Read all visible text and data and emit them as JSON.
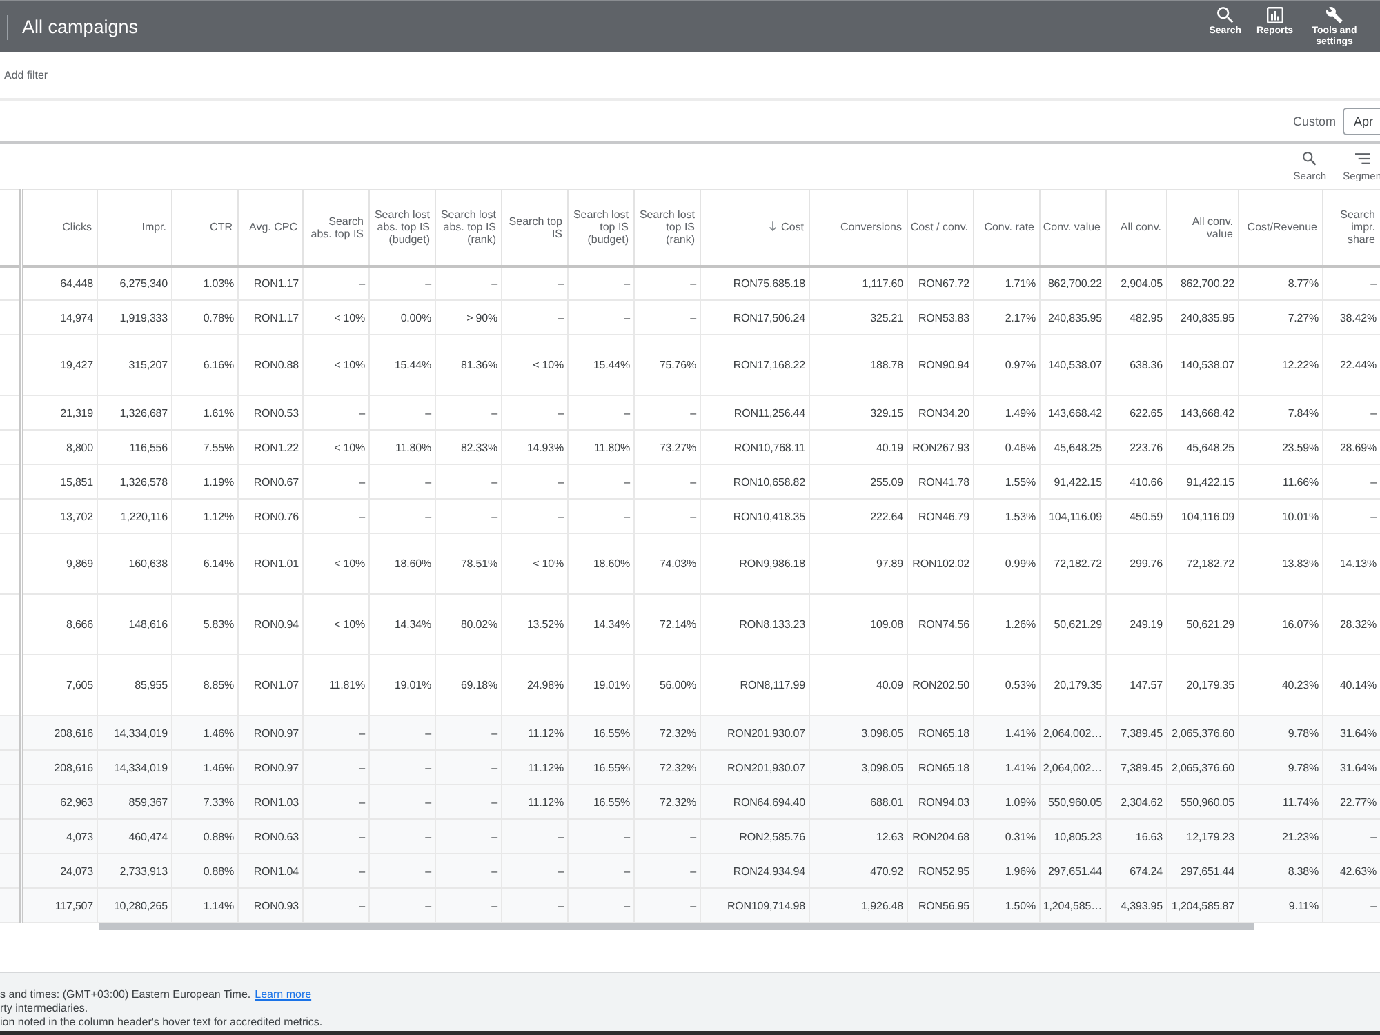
{
  "header": {
    "title": "All campaigns",
    "actions": [
      {
        "kind": "search",
        "label": "Search"
      },
      {
        "kind": "reports",
        "label": "Reports"
      },
      {
        "kind": "tools",
        "label": "Tools and settings"
      }
    ]
  },
  "filter_bar": {
    "label": "Add filter"
  },
  "date_range": {
    "preset": "Custom",
    "value": "Apr"
  },
  "toolbar": [
    {
      "kind": "search",
      "label": "Search"
    },
    {
      "kind": "segment",
      "label": "Segmen"
    }
  ],
  "table": {
    "columns": [
      {
        "label": "Clicks",
        "sorted": false
      },
      {
        "label": "Impr.",
        "sorted": false
      },
      {
        "label": "CTR",
        "sorted": false
      },
      {
        "label": "Avg. CPC",
        "sorted": false
      },
      {
        "label": "Search abs. top IS",
        "sorted": false
      },
      {
        "label": "Search lost abs. top IS (budget)",
        "sorted": false
      },
      {
        "label": "Search lost abs. top IS (rank)",
        "sorted": false
      },
      {
        "label": "Search top IS",
        "sorted": false
      },
      {
        "label": "Search lost top IS (budget)",
        "sorted": false
      },
      {
        "label": "Search lost top IS (rank)",
        "sorted": false
      },
      {
        "label": "Cost",
        "sorted": true
      },
      {
        "label": "Conversions",
        "sorted": false
      },
      {
        "label": "Cost / conv.",
        "sorted": false
      },
      {
        "label": "Conv. rate",
        "sorted": false
      },
      {
        "label": "Conv. value",
        "sorted": false
      },
      {
        "label": "All conv.",
        "sorted": false
      },
      {
        "label": "All conv. value",
        "sorted": false
      },
      {
        "label": "Cost/Revenue",
        "sorted": false
      },
      {
        "label": "Search impr. share",
        "sorted": false
      }
    ],
    "rows": [
      {
        "kind": "campaign",
        "tall": false,
        "cells": [
          "64,448",
          "6,275,340",
          "1.03%",
          "RON1.17",
          "–",
          "–",
          "–",
          "–",
          "–",
          "–",
          "RON75,685.18",
          "1,117.60",
          "RON67.72",
          "1.71%",
          "862,700.22",
          "2,904.05",
          "862,700.22",
          "8.77%",
          "–"
        ]
      },
      {
        "kind": "campaign",
        "tall": false,
        "cells": [
          "14,974",
          "1,919,333",
          "0.78%",
          "RON1.17",
          "< 10%",
          "0.00%",
          "> 90%",
          "–",
          "–",
          "–",
          "RON17,506.24",
          "325.21",
          "RON53.83",
          "2.17%",
          "240,835.95",
          "482.95",
          "240,835.95",
          "7.27%",
          "38.42%"
        ]
      },
      {
        "kind": "campaign",
        "tall": true,
        "cells": [
          "19,427",
          "315,207",
          "6.16%",
          "RON0.88",
          "< 10%",
          "15.44%",
          "81.36%",
          "< 10%",
          "15.44%",
          "75.76%",
          "RON17,168.22",
          "188.78",
          "RON90.94",
          "0.97%",
          "140,538.07",
          "638.36",
          "140,538.07",
          "12.22%",
          "22.44%"
        ]
      },
      {
        "kind": "campaign",
        "tall": false,
        "cells": [
          "21,319",
          "1,326,687",
          "1.61%",
          "RON0.53",
          "–",
          "–",
          "–",
          "–",
          "–",
          "–",
          "RON11,256.44",
          "329.15",
          "RON34.20",
          "1.49%",
          "143,668.42",
          "622.65",
          "143,668.42",
          "7.84%",
          "–"
        ]
      },
      {
        "kind": "campaign",
        "tall": false,
        "cells": [
          "8,800",
          "116,556",
          "7.55%",
          "RON1.22",
          "< 10%",
          "11.80%",
          "82.33%",
          "14.93%",
          "11.80%",
          "73.27%",
          "RON10,768.11",
          "40.19",
          "RON267.93",
          "0.46%",
          "45,648.25",
          "223.76",
          "45,648.25",
          "23.59%",
          "28.69%"
        ]
      },
      {
        "kind": "campaign",
        "tall": false,
        "cells": [
          "15,851",
          "1,326,578",
          "1.19%",
          "RON0.67",
          "–",
          "–",
          "–",
          "–",
          "–",
          "–",
          "RON10,658.82",
          "255.09",
          "RON41.78",
          "1.55%",
          "91,422.15",
          "410.66",
          "91,422.15",
          "11.66%",
          "–"
        ]
      },
      {
        "kind": "campaign",
        "tall": false,
        "cells": [
          "13,702",
          "1,220,116",
          "1.12%",
          "RON0.76",
          "–",
          "–",
          "–",
          "–",
          "–",
          "–",
          "RON10,418.35",
          "222.64",
          "RON46.79",
          "1.53%",
          "104,116.09",
          "450.59",
          "104,116.09",
          "10.01%",
          "–"
        ]
      },
      {
        "kind": "campaign",
        "tall": true,
        "cells": [
          "9,869",
          "160,638",
          "6.14%",
          "RON1.01",
          "< 10%",
          "18.60%",
          "78.51%",
          "< 10%",
          "18.60%",
          "74.03%",
          "RON9,986.18",
          "97.89",
          "RON102.02",
          "0.99%",
          "72,182.72",
          "299.76",
          "72,182.72",
          "13.83%",
          "14.13%"
        ]
      },
      {
        "kind": "campaign",
        "tall": true,
        "cells": [
          "8,666",
          "148,616",
          "5.83%",
          "RON0.94",
          "< 10%",
          "14.34%",
          "80.02%",
          "13.52%",
          "14.34%",
          "72.14%",
          "RON8,133.23",
          "109.08",
          "RON74.56",
          "1.26%",
          "50,621.29",
          "249.19",
          "50,621.29",
          "16.07%",
          "28.32%"
        ]
      },
      {
        "kind": "campaign",
        "tall": true,
        "cells": [
          "7,605",
          "85,955",
          "8.85%",
          "RON1.07",
          "11.81%",
          "19.01%",
          "69.18%",
          "24.98%",
          "19.01%",
          "56.00%",
          "RON8,117.99",
          "40.09",
          "RON202.50",
          "0.53%",
          "20,179.35",
          "147.57",
          "20,179.35",
          "40.23%",
          "40.14%"
        ]
      },
      {
        "kind": "total",
        "tall": false,
        "cells": [
          "208,616",
          "14,334,019",
          "1.46%",
          "RON0.97",
          "–",
          "–",
          "–",
          "11.12%",
          "16.55%",
          "72.32%",
          "RON201,930.07",
          "3,098.05",
          "RON65.18",
          "1.41%",
          "2,064,002…",
          "7,389.45",
          "2,065,376.60",
          "9.78%",
          "31.64%"
        ]
      },
      {
        "kind": "total",
        "tall": false,
        "cells": [
          "208,616",
          "14,334,019",
          "1.46%",
          "RON0.97",
          "–",
          "–",
          "–",
          "11.12%",
          "16.55%",
          "72.32%",
          "RON201,930.07",
          "3,098.05",
          "RON65.18",
          "1.41%",
          "2,064,002…",
          "7,389.45",
          "2,065,376.60",
          "9.78%",
          "31.64%"
        ]
      },
      {
        "kind": "total",
        "tall": false,
        "cells": [
          "62,963",
          "859,367",
          "7.33%",
          "RON1.03",
          "–",
          "–",
          "–",
          "11.12%",
          "16.55%",
          "72.32%",
          "RON64,694.40",
          "688.01",
          "RON94.03",
          "1.09%",
          "550,960.05",
          "2,304.62",
          "550,960.05",
          "11.74%",
          "22.77%"
        ]
      },
      {
        "kind": "total",
        "tall": false,
        "cells": [
          "4,073",
          "460,474",
          "0.88%",
          "RON0.63",
          "–",
          "–",
          "–",
          "–",
          "–",
          "–",
          "RON2,585.76",
          "12.63",
          "RON204.68",
          "0.31%",
          "10,805.23",
          "16.63",
          "12,179.23",
          "21.23%",
          "–"
        ]
      },
      {
        "kind": "total",
        "tall": false,
        "cells": [
          "24,073",
          "2,733,913",
          "0.88%",
          "RON1.04",
          "–",
          "–",
          "–",
          "–",
          "–",
          "–",
          "RON24,934.94",
          "470.92",
          "RON52.95",
          "1.96%",
          "297,651.44",
          "674.24",
          "297,651.44",
          "8.38%",
          "42.63%"
        ]
      },
      {
        "kind": "total",
        "tall": false,
        "cells": [
          "117,507",
          "10,280,265",
          "1.14%",
          "RON0.93",
          "–",
          "–",
          "–",
          "–",
          "–",
          "–",
          "RON109,714.98",
          "1,926.48",
          "RON56.95",
          "1.50%",
          "1,204,585…",
          "4,393.95",
          "1,204,585.87",
          "9.11%",
          "–"
        ]
      }
    ]
  },
  "footer": {
    "notes": [
      {
        "text": "s and times: (GMT+03:00) Eastern European Time.",
        "link": "Learn more"
      },
      {
        "text": "rty intermediaries."
      },
      {
        "text": "ion noted in the column header's hover text for accredited metrics."
      }
    ]
  }
}
